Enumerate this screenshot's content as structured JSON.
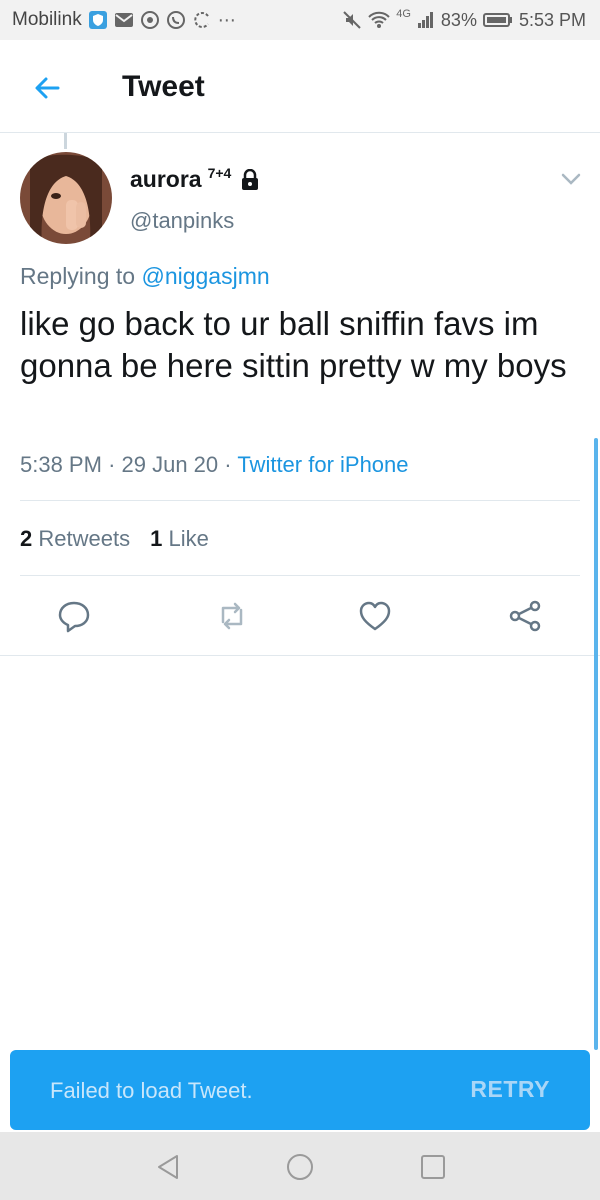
{
  "status_bar": {
    "carrier": "Mobilink",
    "network": "4G",
    "battery": "83%",
    "time": "5:53 PM"
  },
  "header": {
    "title": "Tweet"
  },
  "tweet": {
    "display_name": "aurora",
    "name_suffix": "7+4",
    "handle": "@tanpinks",
    "replying_prefix": "Replying to",
    "replying_to": "@niggasjmn",
    "text": "like go back to ur ball sniffin favs im gonna be here sittin pretty w my boys",
    "time": "5:38 PM",
    "date": "29 Jun 20",
    "separator": "·",
    "source": "Twitter for iPhone",
    "retweets_count": "2",
    "retweets_label": "Retweets",
    "likes_count": "1",
    "likes_label": "Like"
  },
  "snackbar": {
    "message": "Failed to load Tweet.",
    "action": "RETRY"
  },
  "colors": {
    "accent": "#1da1f2",
    "link": "#1b95e0",
    "muted": "#657786"
  }
}
